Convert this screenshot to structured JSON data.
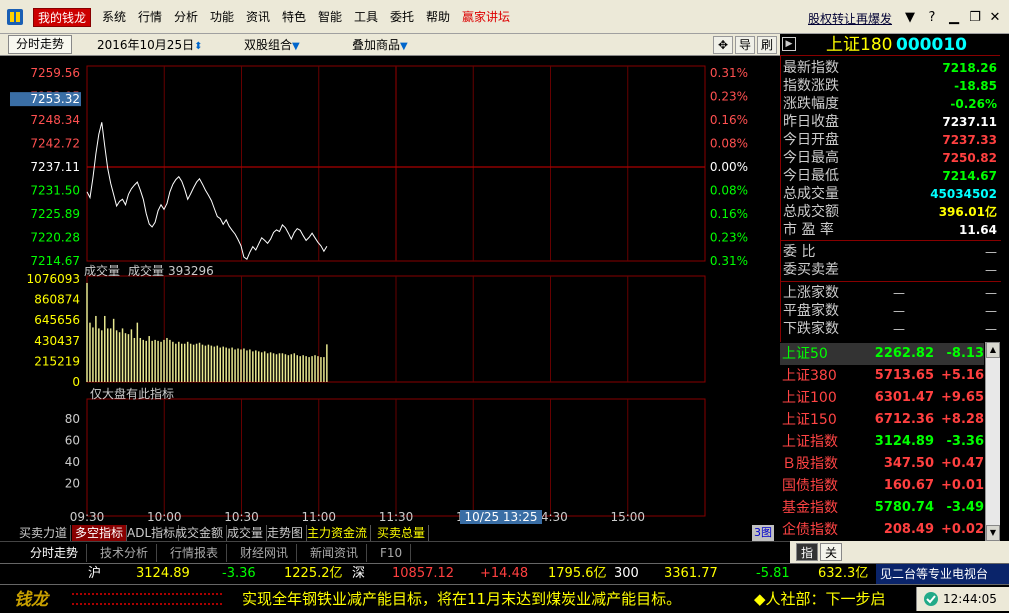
{
  "app": {
    "name": "我的钱龙",
    "menus": [
      "系统",
      "行情",
      "分析",
      "功能",
      "资讯",
      "特色",
      "智能",
      "工具",
      "委托",
      "帮助"
    ],
    "menu_special": "赢家讲坛",
    "top_link": "股权转让再爆发"
  },
  "toolbar": {
    "fenshi": "分时走势",
    "date": "2016年10月25日",
    "combo": "双股组合",
    "overlay": "叠加商品",
    "icon_move": "✥",
    "icon_guide": "导",
    "icon_refresh": "刷"
  },
  "header": {
    "name": "上证180",
    "code": "000010",
    "box": "▶"
  },
  "chart_data": {
    "type": "line",
    "x_labels": [
      "09:30",
      "10:00",
      "10:30",
      "11:00",
      "11:30",
      "14:00",
      "14:30",
      "15:00"
    ],
    "price_left_ticks": [
      "7259.56",
      "7253.95",
      "7248.34",
      "7242.72",
      "7237.11",
      "7231.50",
      "7225.89",
      "7220.28",
      "7214.67"
    ],
    "current_marker": "7253.32",
    "pct_right_ticks": [
      "0.31%",
      "0.23%",
      "0.16%",
      "0.08%",
      "0.00%",
      "0.08%",
      "0.16%",
      "0.23%",
      "0.31%"
    ],
    "y_range": [
      7214.67,
      7259.56
    ],
    "prev_close": 7237.11,
    "price_series": [
      7231.2,
      7229.8,
      7234.5,
      7240.3,
      7244.9,
      7247.8,
      7242.0,
      7236.8,
      7233.2,
      7230.5,
      7227.8,
      7228.9,
      7229.4,
      7228.1,
      7230.6,
      7231.9,
      7232.8,
      7233.5,
      7231.6,
      7229.4,
      7226.0,
      7223.5,
      7222.8,
      7223.9,
      7226.7,
      7228.1,
      7227.0,
      7228.4,
      7231.2,
      7233.0,
      7234.1,
      7234.8,
      7233.7,
      7231.8,
      7229.4,
      7230.7,
      7232.2,
      7233.5,
      7234.3,
      7233.0,
      7231.6,
      7230.4,
      7229.1,
      7227.2,
      7225.3,
      7224.8,
      7223.4,
      7224.5,
      7223.0,
      7222.0,
      7221.1,
      7219.8,
      7218.3,
      7215.6,
      7215.1,
      7216.8,
      7218.1,
      7217.3,
      7218.8,
      7220.2,
      7219.6,
      7218.9,
      7219.9,
      7221.5,
      7222.1,
      7221.7,
      7223.3,
      7222.6,
      7221.3,
      7219.9,
      7221.5,
      7222.4,
      7222.0,
      7220.7,
      7219.6,
      7220.3,
      7221.3,
      7220.2,
      7219.1,
      7218.3,
      7217.0,
      7218.2
    ],
    "volume_title": "成交量",
    "volume_label": "成交量",
    "volume_value": "393296",
    "volume_ticks": [
      "1076093",
      "860874",
      "645656",
      "430437",
      "215219",
      "0"
    ],
    "volume_max": 1076093,
    "volume_series": [
      1035000,
      620000,
      570000,
      690000,
      560000,
      540000,
      690000,
      560000,
      560000,
      660000,
      540000,
      520000,
      560000,
      510000,
      500000,
      550000,
      460000,
      620000,
      460000,
      440000,
      430000,
      480000,
      430000,
      440000,
      430000,
      420000,
      440000,
      460000,
      440000,
      420000,
      400000,
      420000,
      400000,
      400000,
      420000,
      400000,
      390000,
      400000,
      410000,
      390000,
      380000,
      390000,
      380000,
      370000,
      380000,
      360000,
      370000,
      360000,
      350000,
      360000,
      340000,
      350000,
      340000,
      350000,
      330000,
      340000,
      320000,
      330000,
      320000,
      310000,
      320000,
      300000,
      310000,
      300000,
      290000,
      300000,
      300000,
      290000,
      280000,
      290000,
      300000,
      280000,
      270000,
      280000,
      270000,
      260000,
      270000,
      280000,
      270000,
      260000,
      260000,
      393296
    ],
    "indicator_label": "仅大盘有此指标",
    "indicator_ticks": [
      "80",
      "60",
      "40",
      "20"
    ],
    "time_marker": "10/25 13:25"
  },
  "quote": {
    "rows": [
      {
        "label": "最新指数",
        "value": "7218.26",
        "color": "#00ff00"
      },
      {
        "label": "指数涨跌",
        "value": "-18.85",
        "color": "#00ff00"
      },
      {
        "label": "涨跌幅度",
        "value": "-0.26%",
        "color": "#00ff00"
      },
      {
        "label": "昨日收盘",
        "value": "7237.11",
        "color": "#ffffff"
      },
      {
        "label": "今日开盘",
        "value": "7237.33",
        "color": "#ff4040"
      },
      {
        "label": "今日最高",
        "value": "7250.82",
        "color": "#ff4040"
      },
      {
        "label": "今日最低",
        "value": "7214.67",
        "color": "#00ff00"
      },
      {
        "label": "总成交量",
        "value": "45034502",
        "color": "#00ffff"
      },
      {
        "label": "总成交额",
        "value": "396.01亿",
        "color": "#ffff00"
      },
      {
        "label": "市 盈 率",
        "value": "11.64",
        "color": "#ffffff"
      }
    ],
    "weibi": "委    比",
    "weicha": "委买卖差",
    "weibi_val": "—",
    "weicha_val": "—",
    "breadth": [
      {
        "label": "上涨家数",
        "a": "—",
        "b": "—"
      },
      {
        "label": "平盘家数",
        "a": "—",
        "b": "—"
      },
      {
        "label": "下跌家数",
        "a": "—",
        "b": "—"
      }
    ]
  },
  "index_list": [
    {
      "name": "上证50",
      "price": "2262.82",
      "change": "-8.13",
      "pc": "#00ff00",
      "cc": "#00ff00",
      "sel": true
    },
    {
      "name": "上证380",
      "price": "5713.65",
      "change": "+5.16",
      "pc": "#ff4040",
      "cc": "#ff4040",
      "sel": false
    },
    {
      "name": "上证100",
      "price": "6301.47",
      "change": "+9.65",
      "pc": "#ff4040",
      "cc": "#ff4040",
      "sel": false
    },
    {
      "name": "上证150",
      "price": "6712.36",
      "change": "+8.28",
      "pc": "#ff4040",
      "cc": "#ff4040",
      "sel": false
    },
    {
      "name": "上证指数",
      "price": "3124.89",
      "change": "-3.36",
      "pc": "#00ff00",
      "cc": "#00ff00",
      "sel": false
    },
    {
      "name": "Ｂ股指数",
      "price": "347.50",
      "change": "+0.47",
      "pc": "#ff4040",
      "cc": "#ff4040",
      "sel": false
    },
    {
      "name": "国债指数",
      "price": "160.67",
      "change": "+0.01",
      "pc": "#ff4040",
      "cc": "#ff4040",
      "sel": false
    },
    {
      "name": "基金指数",
      "price": "5780.74",
      "change": "-3.49",
      "pc": "#00ff00",
      "cc": "#00ff00",
      "sel": false
    },
    {
      "name": "企债指数",
      "price": "208.49",
      "change": "+0.02",
      "pc": "#ff4040",
      "cc": "#ff4040",
      "sel": false
    }
  ],
  "indicator_tabs": [
    {
      "label": "买卖力道",
      "cls": ""
    },
    {
      "label": "多空指标",
      "cls": "active"
    },
    {
      "label": "ADL指标",
      "cls": ""
    },
    {
      "label": "成交金额",
      "cls": ""
    },
    {
      "label": "成交量",
      "cls": ""
    },
    {
      "label": "走势图",
      "cls": ""
    },
    {
      "label": "主力资金流",
      "cls": "yellow"
    },
    {
      "label": "买卖总量",
      "cls": "yellow"
    }
  ],
  "tab3": "3图",
  "func_tabs": [
    "分时走势",
    "技术分析",
    "行情报表",
    "财经网讯",
    "新闻资讯",
    "F10"
  ],
  "right_tabs": [
    "指",
    "关"
  ],
  "ticker": [
    {
      "t": "沪",
      "c": "#ffffff"
    },
    {
      "t": "3124.89",
      "c": "#ffff00"
    },
    {
      "t": "-3.36",
      "c": "#00ff00"
    },
    {
      "t": "1225.2亿",
      "c": "#ffff00"
    },
    {
      "t": "深",
      "c": "#ffffff"
    },
    {
      "t": "10857.12",
      "c": "#ff4040"
    },
    {
      "t": "+14.48",
      "c": "#ff4040"
    },
    {
      "t": "1795.6亿",
      "c": "#ffff00"
    },
    {
      "t": "300",
      "c": "#ffffff"
    },
    {
      "t": "3361.77",
      "c": "#ffff00"
    },
    {
      "t": "-5.81",
      "c": "#00ff00"
    },
    {
      "t": "632.3亿",
      "c": "#ffff00"
    }
  ],
  "tv_box": "见二台等专业电视台",
  "brand": "钱龙",
  "news": "实现全年钢铁业减产能目标，将在11月末达到煤炭业减产能目标。",
  "news2": "◆人社部：下一步启",
  "clock": "12:44:05"
}
